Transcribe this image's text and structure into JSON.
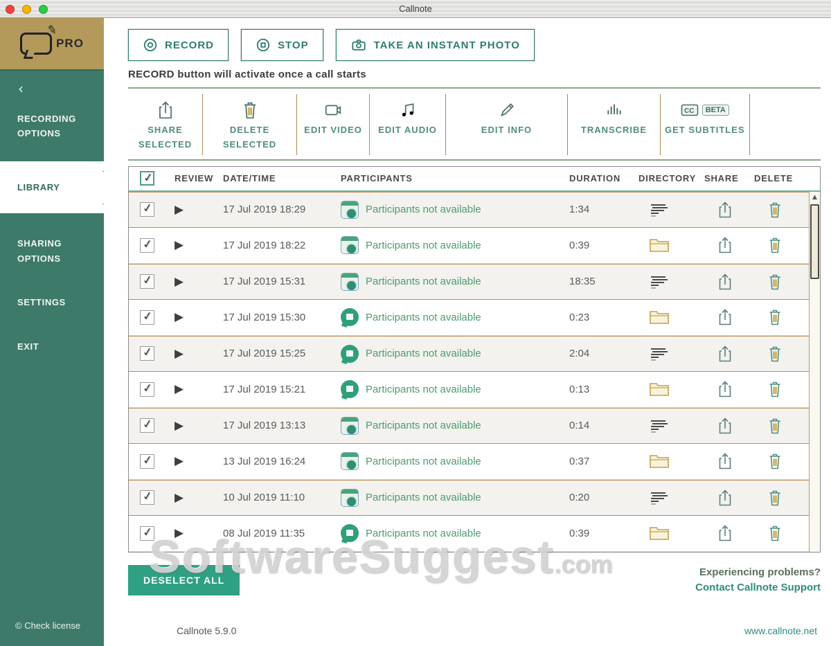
{
  "window": {
    "title": "Callnote"
  },
  "colors": {
    "sidebar_teal": "#3d7a6a",
    "logo_gold": "#b39a5b",
    "accent_teal": "#2f7d6e",
    "deselect_green": "#2fa083",
    "row_border_tan": "#b48e51"
  },
  "sidebar": {
    "logo_text": "PRO",
    "back_icon": "‹",
    "items": [
      {
        "label": "RECORDING OPTIONS",
        "state": ""
      },
      {
        "label": "LIBRARY",
        "state": "active"
      },
      {
        "label": "SHARING OPTIONS",
        "state": ""
      },
      {
        "label": "SETTINGS",
        "state": ""
      },
      {
        "label": "EXIT",
        "state": ""
      }
    ],
    "license_label": "© Check license"
  },
  "toolbar": {
    "record_label": "RECORD",
    "stop_label": "STOP",
    "photo_label": "TAKE AN INSTANT PHOTO",
    "hint": "RECORD button will activate once a call starts"
  },
  "actions": [
    {
      "label": "SHARE SELECTED",
      "icon": "share-icon",
      "badge": ""
    },
    {
      "label": "DELETE SELECTED",
      "icon": "trash-icon",
      "badge": ""
    },
    {
      "label": "EDIT VIDEO",
      "icon": "video-icon",
      "badge": ""
    },
    {
      "label": "EDIT AUDIO",
      "icon": "music-icon",
      "badge": ""
    },
    {
      "label": "EDIT INFO",
      "icon": "pencil-icon",
      "badge": ""
    },
    {
      "label": "TRANSCRIBE",
      "icon": "transcribe-icon",
      "badge": ""
    },
    {
      "label": "GET SUBTITLES",
      "icon": "cc-icon",
      "badge": "BETA"
    }
  ],
  "table": {
    "headers": {
      "review": "REVIEW",
      "datetime": "DATE/TIME",
      "participants": "PARTICIPANTS",
      "duration": "DURATION",
      "directory": "DIRECTORY",
      "share": "SHARE",
      "delete": "DELETE"
    },
    "rows": [
      {
        "datetime": "17 Jul 2019 18:29",
        "participants": "Participants not available",
        "duration": "1:34",
        "app": "square",
        "dir": "lines"
      },
      {
        "datetime": "17 Jul 2019 18:22",
        "participants": "Participants not available",
        "duration": "0:39",
        "app": "square",
        "dir": "folder"
      },
      {
        "datetime": "17 Jul 2019 15:31",
        "participants": "Participants not available",
        "duration": "18:35",
        "app": "square",
        "dir": "lines"
      },
      {
        "datetime": "17 Jul 2019 15:30",
        "participants": "Participants not available",
        "duration": "0:23",
        "app": "round",
        "dir": "folder"
      },
      {
        "datetime": "17 Jul 2019 15:25",
        "participants": "Participants not available",
        "duration": "2:04",
        "app": "round",
        "dir": "lines"
      },
      {
        "datetime": "17 Jul 2019 15:21",
        "participants": "Participants not available",
        "duration": "0:13",
        "app": "round",
        "dir": "folder"
      },
      {
        "datetime": "17 Jul 2019 13:13",
        "participants": "Participants not available",
        "duration": "0:14",
        "app": "square",
        "dir": "lines"
      },
      {
        "datetime": "13 Jul 2019 16:24",
        "participants": "Participants not available",
        "duration": "0:37",
        "app": "square",
        "dir": "folder"
      },
      {
        "datetime": "10 Jul 2019 11:10",
        "participants": "Participants not available",
        "duration": "0:20",
        "app": "square",
        "dir": "lines"
      },
      {
        "datetime": "08 Jul 2019 11:35",
        "participants": "Participants not available",
        "duration": "0:39",
        "app": "round",
        "dir": "folder"
      }
    ]
  },
  "bottom": {
    "deselect_label": "DESELECT ALL",
    "support_line1": "Experiencing problems?",
    "support_line2": "Contact Callnote Support"
  },
  "footer": {
    "version": "Callnote 5.9.0",
    "website": "www.callnote.net"
  },
  "watermark": {
    "main": "SoftwareSuggest",
    "suffix": ".com"
  }
}
